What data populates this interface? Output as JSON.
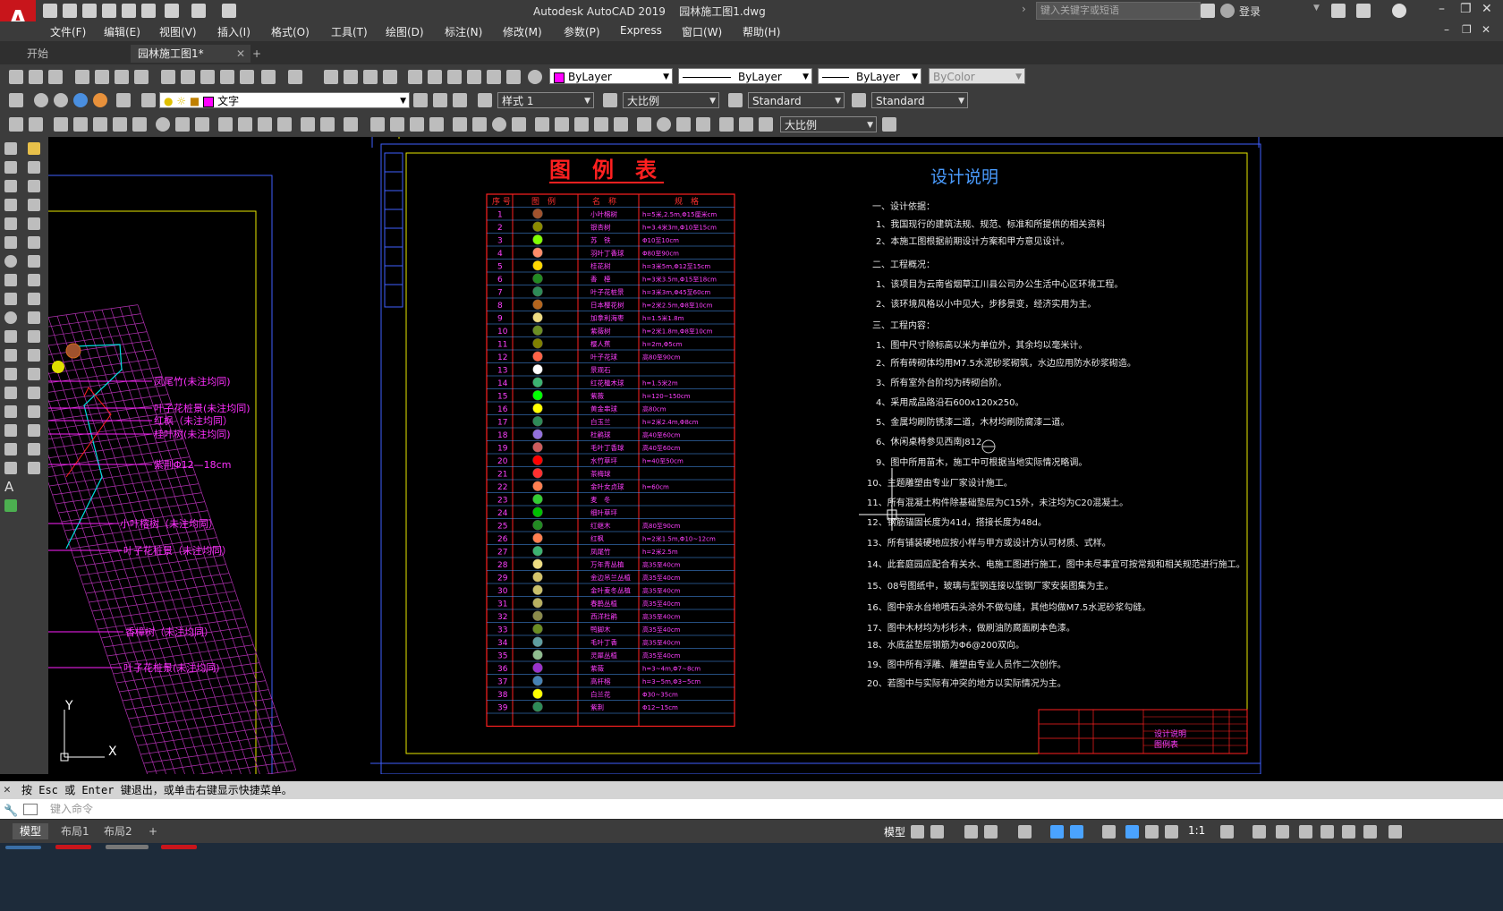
{
  "app": {
    "title": "Autodesk AutoCAD 2019",
    "filename": "园林施工图1.dwg"
  },
  "search": {
    "placeholder": "键入关键字或短语"
  },
  "account": {
    "login": "登录"
  },
  "menu": [
    "文件(F)",
    "编辑(E)",
    "视图(V)",
    "插入(I)",
    "格式(O)",
    "工具(T)",
    "绘图(D)",
    "标注(N)",
    "修改(M)",
    "参数(P)",
    "Express",
    "窗口(W)",
    "帮助(H)"
  ],
  "doc_tabs": [
    {
      "label": "开始"
    },
    {
      "label": "园林施工图1*"
    }
  ],
  "properties": {
    "color": "ByLayer",
    "linetype": "ByLayer",
    "lineweight": "ByLayer",
    "plotstyle": "ByColor"
  },
  "layers": {
    "current": "文字",
    "text_style": "样式 1",
    "dim_style": "大比例",
    "table_style": "Standard",
    "mleader_style": "Standard",
    "dim_style2": "大比例"
  },
  "drawing": {
    "legend_title": "图　例　表",
    "legend_headers": [
      "序 号",
      "图　例",
      "名　称",
      "规　格"
    ],
    "legend_rows": [
      {
        "no": "1",
        "name": "小叶榕树",
        "spec": "h=5米,2.5m,Φ15厘米cm",
        "color": "#a0522d"
      },
      {
        "no": "2",
        "name": "银杏树",
        "spec": "h=3.4米3m,Φ10至15cm",
        "color": "#8b8b00"
      },
      {
        "no": "3",
        "name": "苏　铁",
        "spec": "Φ10至10cm",
        "color": "#7fff00"
      },
      {
        "no": "4",
        "name": "羽叶丁香球",
        "spec": "Φ80至90cm",
        "color": "#ff8c69"
      },
      {
        "no": "5",
        "name": "桂花树",
        "spec": "h=3米5m,Φ12至15cm",
        "color": "#ffd700"
      },
      {
        "no": "6",
        "name": "香　樟",
        "spec": "h=3米3.5m,Φ15至18cm",
        "color": "#228b22"
      },
      {
        "no": "7",
        "name": "叶子花桩景",
        "spec": "h=3米3m,Φ45至60cm",
        "color": "#2e8b57"
      },
      {
        "no": "8",
        "name": "日本樱花树",
        "spec": "h=2米2.5m,Φ8至10cm",
        "color": "#b5651d"
      },
      {
        "no": "9",
        "name": "加拿利海枣",
        "spec": "h=1.5米1.8m",
        "color": "#eedc82"
      },
      {
        "no": "10",
        "name": "紫薇树",
        "spec": "h=2米1.8m,Φ8至10cm",
        "color": "#6b8e23"
      },
      {
        "no": "11",
        "name": "樱人蕉",
        "spec": "h=2m,Φ5cm",
        "color": "#808000"
      },
      {
        "no": "12",
        "name": "叶子花球",
        "spec": "高80至90cm",
        "color": "#ff6347"
      },
      {
        "no": "13",
        "name": "景观石",
        "spec": "",
        "color": "#ffffff"
      },
      {
        "no": "14",
        "name": "红花檵木球",
        "spec": "h=1.5米2m",
        "color": "#3cb371"
      },
      {
        "no": "15",
        "name": "紫薇",
        "spec": "h=120~150cm",
        "color": "#00ff00"
      },
      {
        "no": "16",
        "name": "黄金串球",
        "spec": "高80cm",
        "color": "#ffff00"
      },
      {
        "no": "17",
        "name": "白玉兰",
        "spec": "h=2米2.4m,Φ8cm",
        "color": "#2e8b57"
      },
      {
        "no": "18",
        "name": "杜鹃球",
        "spec": "高40至60cm",
        "color": "#9370db"
      },
      {
        "no": "19",
        "name": "毛叶丁香球",
        "spec": "高40至60cm",
        "color": "#cd5c5c"
      },
      {
        "no": "20",
        "name": "水竹草坪",
        "spec": "h=40至50cm",
        "color": "#ff0000"
      },
      {
        "no": "21",
        "name": "茶梅球",
        "spec": "",
        "color": "#ff3030"
      },
      {
        "no": "22",
        "name": "金叶女贞球",
        "spec": "h=60cm",
        "color": "#ff7f50"
      },
      {
        "no": "23",
        "name": "麦　冬",
        "spec": "",
        "color": "#32cd32"
      },
      {
        "no": "24",
        "name": "细叶草坪",
        "spec": "",
        "color": "#00c000"
      },
      {
        "no": "25",
        "name": "红继木",
        "spec": "高80至90cm",
        "color": "#228b22"
      },
      {
        "no": "26",
        "name": "红枫",
        "spec": "h=2米1.5m,Φ10~12cm",
        "color": "#ff7f50"
      },
      {
        "no": "27",
        "name": "凤尾竹",
        "spec": "h=2米2.5m",
        "color": "#3cb371"
      },
      {
        "no": "28",
        "name": "万年青丛植",
        "spec": "高35至40cm",
        "color": "#eedd82"
      },
      {
        "no": "29",
        "name": "金边吊兰丛植",
        "spec": "高35至40cm",
        "color": "#d4c36a"
      },
      {
        "no": "30",
        "name": "金叶麦冬丛植",
        "spec": "高35至40cm",
        "color": "#c9c06a"
      },
      {
        "no": "31",
        "name": "春鹃丛植",
        "spec": "高35至40cm",
        "color": "#b8b060"
      },
      {
        "no": "32",
        "name": "西洋杜鹃",
        "spec": "高35至40cm",
        "color": "#8b8b4b"
      },
      {
        "no": "33",
        "name": "鸭脚木",
        "spec": "高35至40cm",
        "color": "#6b8e23"
      },
      {
        "no": "34",
        "name": "毛叶丁香",
        "spec": "高35至40cm",
        "color": "#5f9ea0"
      },
      {
        "no": "35",
        "name": "灵犀丛植",
        "spec": "高35至40cm",
        "color": "#8fbc8f"
      },
      {
        "no": "36",
        "name": "紫薇",
        "spec": "h=3~4m,Φ7~8cm",
        "color": "#9932cc"
      },
      {
        "no": "37",
        "name": "高杆榕",
        "spec": "h=3~5m,Φ3~5cm",
        "color": "#4682b4"
      },
      {
        "no": "38",
        "name": "白兰花",
        "spec": "Φ30~35cm",
        "color": "#ffff00"
      },
      {
        "no": "39",
        "name": "紫荆",
        "spec": "Φ12~15cm",
        "color": "#2e8b57"
      }
    ],
    "notes_title": "设计说明",
    "notes": [
      "一、设计依据：",
      "1、我国现行的建筑法规、规范、标准和所提供的相关资料",
      "2、本施工图根据前期设计方案和甲方意见设计。",
      "二、工程概况：",
      "1、该项目为云南省烟草江川县公司办公生活中心区环境工程。",
      "2、该环境风格以小中见大，步移景变，经济实用为主。",
      "三、工程内容：",
      "1、图中尺寸除标高以米为单位外，其余均以毫米计。",
      "2、所有砖砌体均用M7.5水泥砂浆砌筑，水边应用防水砂浆砌造。",
      "3、所有室外台阶均为砖砌台阶。",
      "4、采用成品路沿石600x120x250。",
      "5、金属均刷防锈漆二道，木材均刷防腐漆二道。",
      "6、休闲桌椅参见西南J812",
      "9、图中所用苗木，施工中可根据当地实际情况略调。",
      "10、主题雕塑由专业厂家设计施工。",
      "11、所有混凝土构件除基础垫层为C15外，未注均为C20混凝土。",
      "12、钢筋锚固长度为41d，搭接长度为48d。",
      "13、所有铺装硬地应按小样与甲方或设计方认可材质、式样。",
      "14、此套庭园应配合有关水、电施工图进行施工，图中未尽事宜可按常规和相关规范进行施工。",
      "15、08号图纸中，玻璃与型钢连接以型钢厂家安装图集为主。",
      "16、图中亲水台地喷石头涂外不做勾缝，其他均做M7.5水泥砂浆勾缝。",
      "17、图中木材均为杉杉木，做刷油防腐面刷本色漆。",
      "18、水底盆垫层钢筋为Φ6@200双向。",
      "19、图中所有浮雕、雕塑由专业人员作二次创作。",
      "20、若图中与实际有冲突的地方以实际情况为主。"
    ],
    "titleblock": {
      "sheet_title": "设计说明",
      "sheet_sub": "图例表"
    },
    "left_labels": [
      "凤尾竹(未注均同)",
      "叶子花桩景(未注均同)",
      "红枫（未注均同）",
      "桂叶树(未注均同)",
      "紫荆Φ12—18cm",
      "小叶榕树（未注均同）",
      "叶子花桩景（未注均同）",
      "香樟树（未注均同）",
      "叶子花桩景(未注均同)"
    ],
    "ucs": {
      "x": "X",
      "y": "Y"
    }
  },
  "command": {
    "history": "按 Esc 或 Enter 键退出，或单击右键显示快捷菜单。",
    "placeholder": "键入命令"
  },
  "layout_tabs": [
    "模型",
    "布局1",
    "布局2"
  ],
  "status": {
    "model": "模型",
    "scale": "1:1"
  }
}
